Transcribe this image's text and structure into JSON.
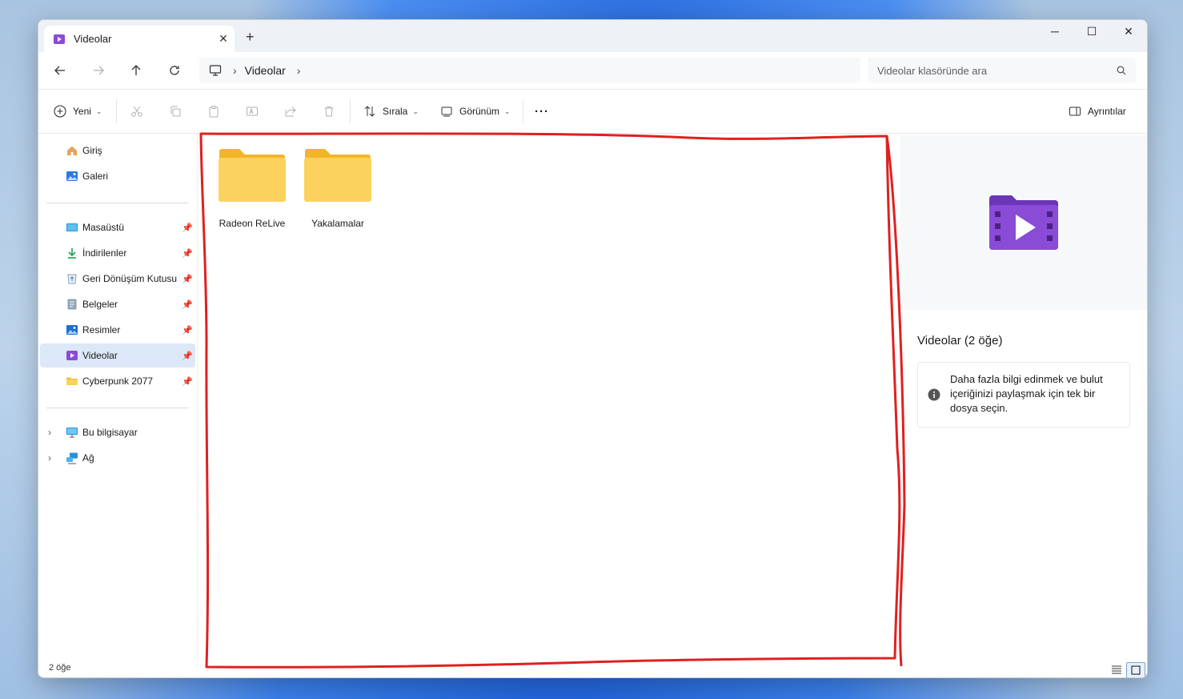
{
  "window": {
    "tab_title": "Videolar",
    "tab_close": "✕",
    "new_tab": "+",
    "minimize": "─",
    "maximize": "☐",
    "close": "✕"
  },
  "address": {
    "crumbs": [
      "Videolar"
    ],
    "search_placeholder": "Videolar klasöründe ara"
  },
  "toolbar": {
    "new_label": "Yeni",
    "sort_label": "Sırala",
    "view_label": "Görünüm",
    "more_label": "···",
    "details_label": "Ayrıntılar"
  },
  "sidebar": {
    "top_items": [
      {
        "label": "Giriş",
        "icon": "home-icon"
      },
      {
        "label": "Galeri",
        "icon": "gallery-icon"
      }
    ],
    "pinned_items": [
      {
        "label": "Masaüstü",
        "icon": "desktop-icon"
      },
      {
        "label": "İndirilenler",
        "icon": "download-icon"
      },
      {
        "label": "Geri Dönüşüm Kutusu",
        "icon": "recycle-bin-icon"
      },
      {
        "label": "Belgeler",
        "icon": "documents-icon"
      },
      {
        "label": "Resimler",
        "icon": "pictures-icon"
      },
      {
        "label": "Videolar",
        "icon": "videos-icon",
        "selected": true
      },
      {
        "label": "Cyberpunk 2077",
        "icon": "folder-icon"
      }
    ],
    "bottom_items": [
      {
        "label": "Bu bilgisayar",
        "icon": "this-pc-icon"
      },
      {
        "label": "Ağ",
        "icon": "network-icon"
      }
    ]
  },
  "content": {
    "folders": [
      {
        "label": "Radeon ReLive",
        "icon": "folder-icon"
      },
      {
        "label": "Yakalamalar",
        "icon": "folder-icon"
      }
    ]
  },
  "details": {
    "title": "Videolar (2 öğe)",
    "info_text": "Daha fazla bilgi edinmek ve bulut içeriğinizi paylaşmak için tek bir dosya seçin."
  },
  "status": {
    "item_count": "2 öğe"
  },
  "colors": {
    "annotation": "#e02020",
    "selected_bg": "#dce8f7",
    "folder_yellow": "#f8c53a",
    "video_purple": "#7b3fc4"
  }
}
